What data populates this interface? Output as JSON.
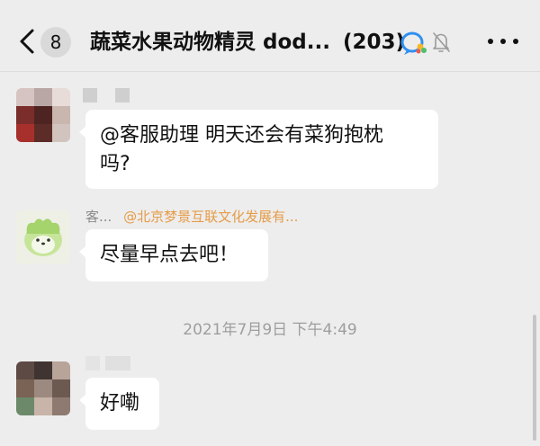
{
  "header": {
    "back_icon": "chevron-left-icon",
    "unread_count": "8",
    "title": "蔬菜水果动物精灵 dod...",
    "member_count": "(203)",
    "work_icon": "enterprise-chat-icon",
    "mute_icon": "bell-muted-icon",
    "more_icon": "more-dots-icon"
  },
  "messages": [
    {
      "sender_name": "",
      "text_line1": "@客服助理 明天还会有菜狗抱枕",
      "text_line2": "吗?"
    },
    {
      "sender_name": "客...",
      "sender_org": "@北京梦景互联文化发展有...",
      "text": "尽量早点去吧！"
    },
    {
      "sender_name": "",
      "text": "好嘞"
    }
  ],
  "timestamp": "2021年7月9日 下午4:49",
  "colors": {
    "background": "#ededed",
    "bubble": "#ffffff",
    "org_label": "#e69c48",
    "meta_text": "#9e9e9e"
  }
}
